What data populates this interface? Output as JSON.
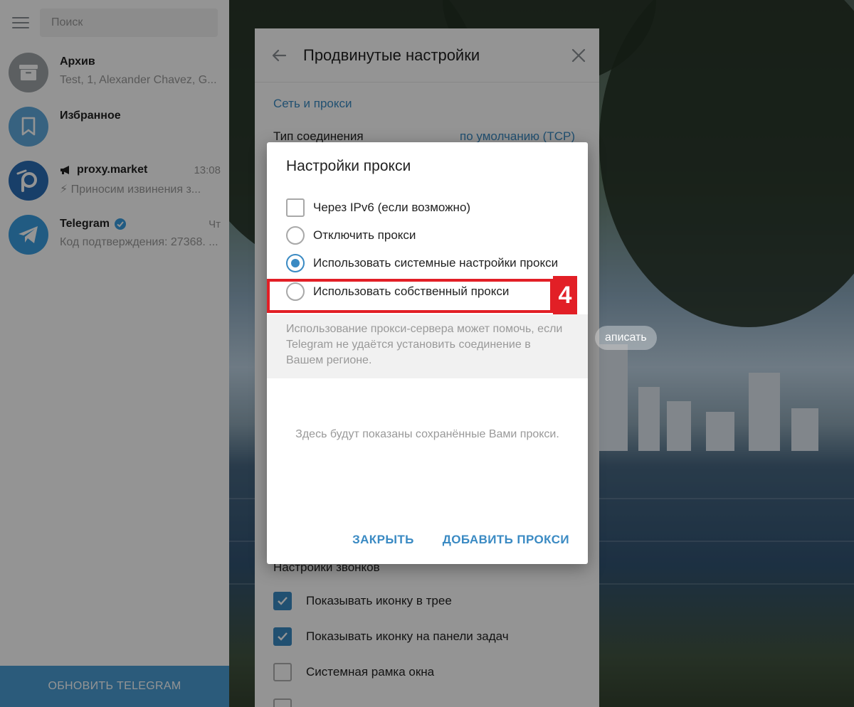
{
  "sidebar": {
    "search_placeholder": "Поиск",
    "chats": [
      {
        "name": "Архив",
        "message": "Test, 1, Alexander Chavez, G...",
        "time": "",
        "avatar_icon": "archive-icon",
        "avatar_color": "#9fa4a8"
      },
      {
        "name": "Избранное",
        "message": "",
        "time": "",
        "avatar_icon": "bookmark-icon",
        "avatar_color": "#5fa9dc"
      },
      {
        "name": "proxy.market",
        "message": "⚡ Приносим извинения з...",
        "time": "13:08",
        "avatar_icon": "proxy-market-logo",
        "avatar_color": "#2a6db5",
        "name_prefix_icon": "megaphone-icon"
      },
      {
        "name": "Telegram",
        "message": "Код подтверждения: 27368. ...",
        "time": "Чт",
        "avatar_icon": "telegram-plane-icon",
        "avatar_color": "#3a9ee0",
        "verified": true
      }
    ],
    "update_button": "ОБНОВИТЬ TELEGRAM"
  },
  "settings_panel": {
    "title": "Продвинутые настройки",
    "section_network": "Сеть и прокси",
    "connection_type_label": "Тип соединения",
    "connection_type_value": "по умолчанию (TCP)",
    "partially_hidden_button": "аписать",
    "calls_section_title": "Настройки звонков",
    "checkboxes": [
      {
        "label": "Показывать иконку в трее",
        "checked": true
      },
      {
        "label": "Показывать иконку на панели задач",
        "checked": true
      },
      {
        "label": "Системная рамка окна",
        "checked": false
      }
    ]
  },
  "proxy_dialog": {
    "title": "Настройки прокси",
    "ipv6_label": "Через IPv6 (если возможно)",
    "ipv6_checked": false,
    "options": [
      {
        "label": "Отключить прокси",
        "selected": false
      },
      {
        "label": "Использовать системные настройки прокси",
        "selected": true
      },
      {
        "label": "Использовать собственный прокси",
        "selected": false
      }
    ],
    "hint": "Использование прокси-сервера может помочь, если Telegram не удаётся установить соединение в Вашем регионе.",
    "empty_state": "Здесь будут показаны сохранённые Вами прокси.",
    "close_button": "ЗАКРЫТЬ",
    "add_button": "ДОБАВИТЬ ПРОКСИ"
  },
  "annotation": {
    "step_number": "4",
    "color": "#e21f26"
  },
  "colors": {
    "accent": "#3a8ac3",
    "update_bar": "#4a9ed4"
  }
}
